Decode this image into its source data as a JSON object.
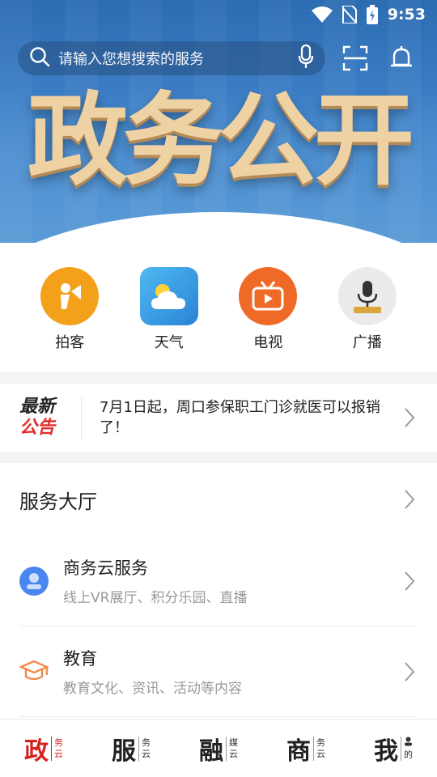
{
  "status_bar": {
    "time": "9:53"
  },
  "search": {
    "placeholder": "请输入您想搜索的服务"
  },
  "banner": {
    "text": "政务公开"
  },
  "quick_apps": [
    {
      "label": "拍客",
      "icon": "paike-icon",
      "color": "#f3a01a"
    },
    {
      "label": "天气",
      "icon": "weather-icon",
      "color": "#3aa3e8"
    },
    {
      "label": "电视",
      "icon": "tv-icon",
      "color": "#f06a27"
    },
    {
      "label": "广播",
      "icon": "radio-icon",
      "color": "#e9e9e9"
    }
  ],
  "notice": {
    "tag_line1": "最新",
    "tag_line2": "公告",
    "text": "7月1日起，周口参保职工门诊就医可以报销了！"
  },
  "services": {
    "title": "服务大厅",
    "items": [
      {
        "name": "商务云服务",
        "desc": "线上VR展厅、积分乐园、直播",
        "icon": "user-badge-icon"
      },
      {
        "name": "教育",
        "desc": "教育文化、资讯、活动等内容",
        "icon": "graduation-cap-icon"
      }
    ]
  },
  "bottom_nav": [
    {
      "big": "政",
      "small1": "务",
      "small2": "云",
      "active": true
    },
    {
      "big": "服",
      "small1": "务",
      "small2": "云",
      "active": false
    },
    {
      "big": "融",
      "small1": "媒",
      "small2": "云",
      "active": false
    },
    {
      "big": "商",
      "small1": "务",
      "small2": "云",
      "active": false
    },
    {
      "big": "我",
      "small1": "",
      "small2": "的",
      "active": false
    }
  ],
  "colors": {
    "accent_red": "#d3231f",
    "orange": "#f06a27"
  }
}
